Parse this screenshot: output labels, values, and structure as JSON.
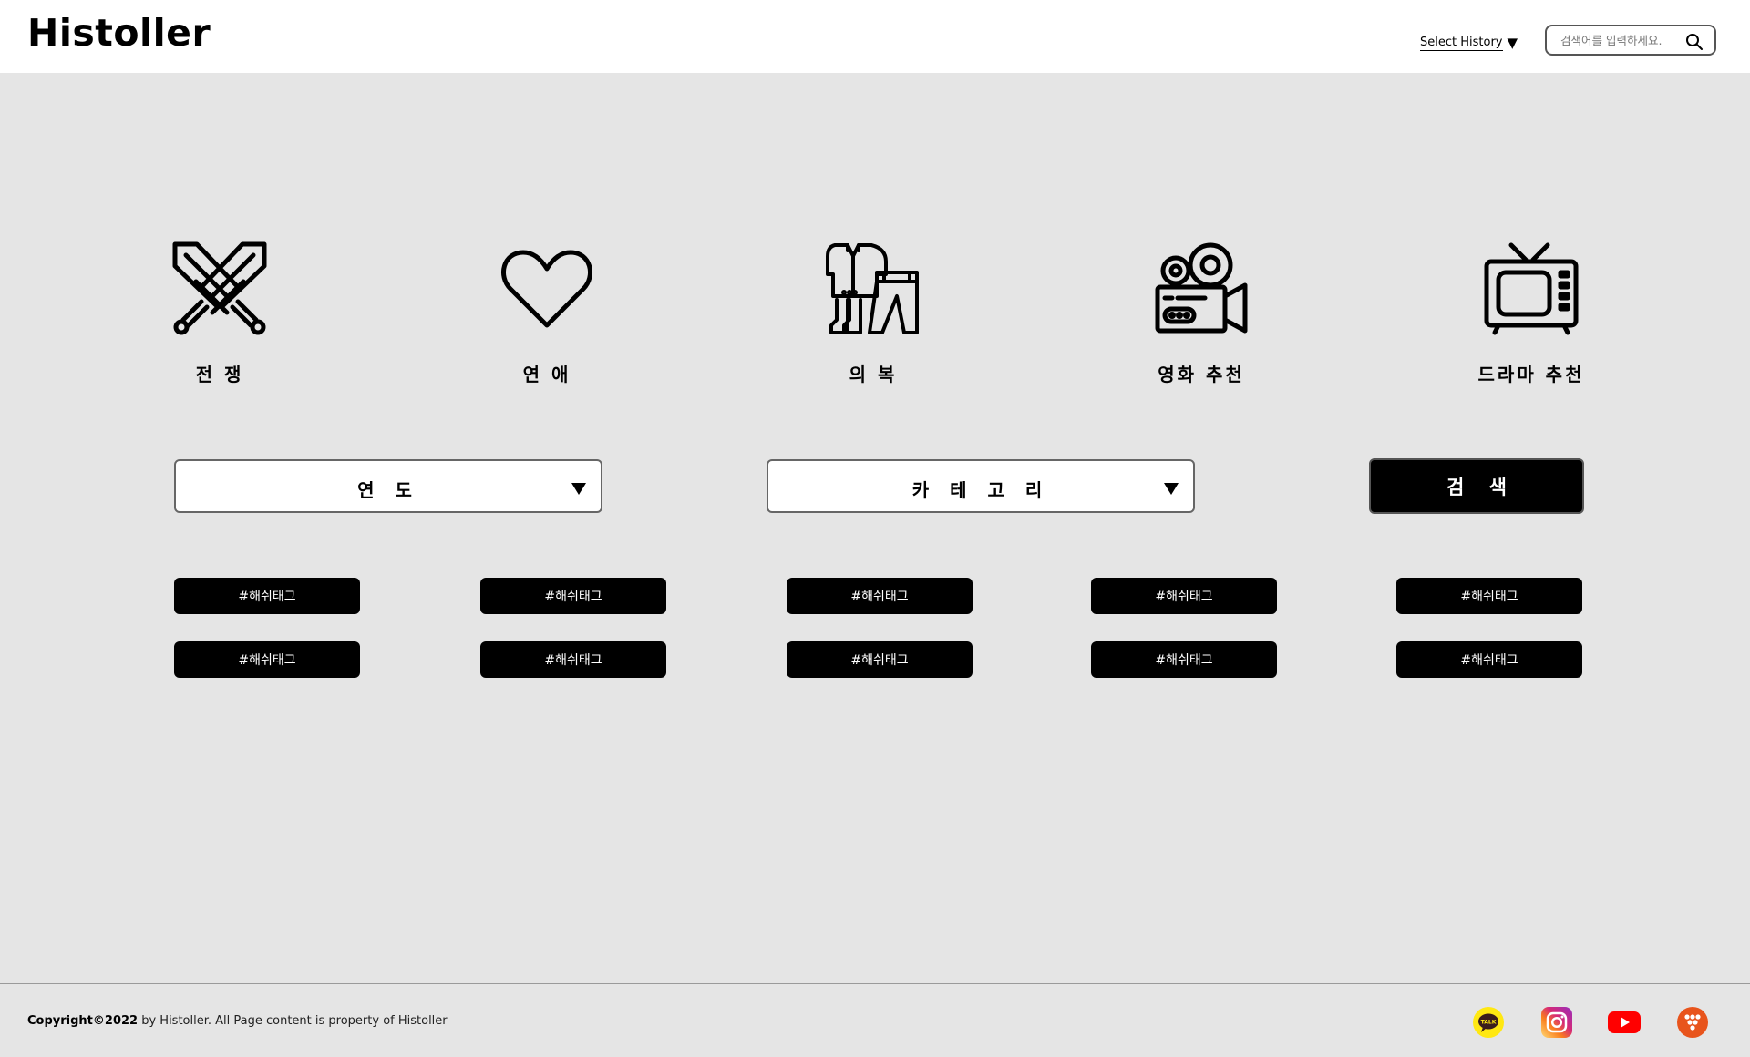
{
  "header": {
    "logo": "Histoller",
    "history_select": "Select History",
    "search_placeholder": "검색어를 입력하세요."
  },
  "categories": [
    {
      "label": "전 쟁",
      "icon": "crossed-swords-icon"
    },
    {
      "label": "연 애",
      "icon": "heart-icon"
    },
    {
      "label": "의 복",
      "icon": "clothing-icon"
    },
    {
      "label": "영화 추천",
      "icon": "movie-camera-icon"
    },
    {
      "label": "드라마 추천",
      "icon": "television-icon"
    }
  ],
  "filters": {
    "year_label": "연 도",
    "category_label": "카 테 고 리",
    "search_button": "검 색"
  },
  "hashtags": [
    "#해쉬태그",
    "#해쉬태그",
    "#해쉬태그",
    "#해쉬태그",
    "#해쉬태그",
    "#해쉬태그",
    "#해쉬태그",
    "#해쉬태그",
    "#해쉬태그",
    "#해쉬태그"
  ],
  "footer": {
    "copyright_bold": "Copyright©2022",
    "copyright_rest": " by Histoller. All Page content is property of Histoller",
    "social": [
      "kakaotalk-icon",
      "instagram-icon",
      "youtube-icon",
      "twitch-icon"
    ],
    "social_colors": {
      "kakao": "#FFE812",
      "instagram": "#E1306C",
      "youtube": "#FF0000",
      "other": "#E8541C"
    }
  }
}
